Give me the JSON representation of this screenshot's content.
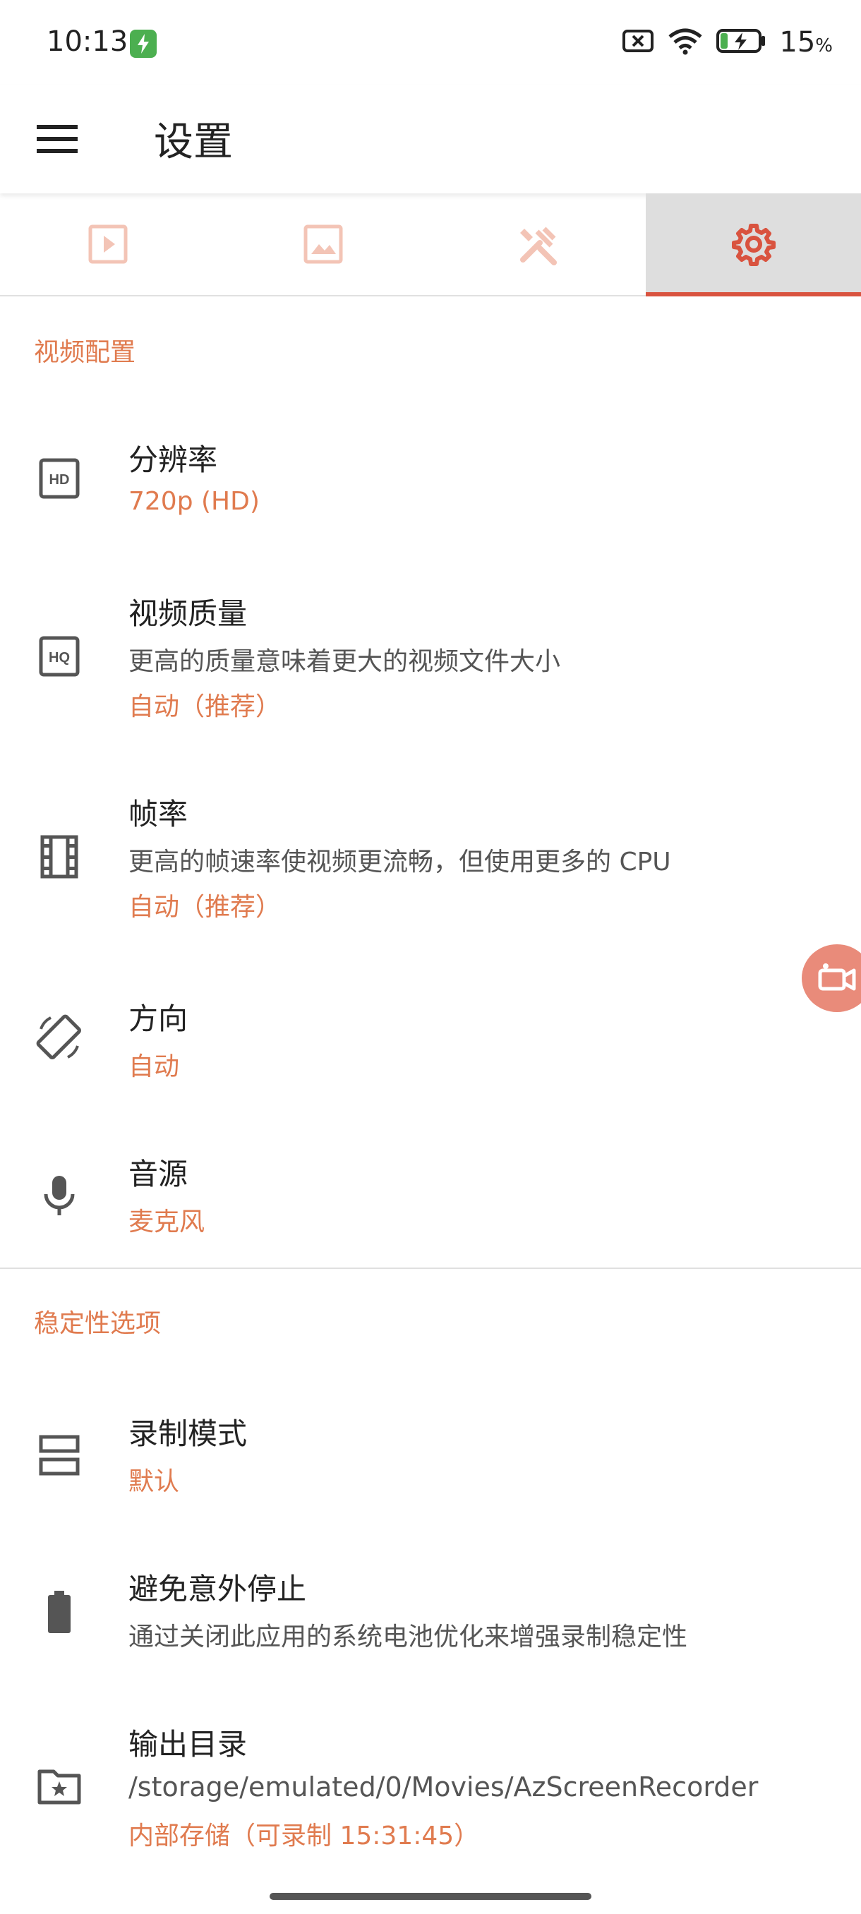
{
  "status_bar": {
    "time": "10:13",
    "battery_pct": "15",
    "battery_unit": "%"
  },
  "app_bar": {
    "title": "设置"
  },
  "tabs": [
    {
      "name": "video",
      "icon": "play-icon",
      "active": false
    },
    {
      "name": "image",
      "icon": "image-icon",
      "active": false
    },
    {
      "name": "tools",
      "icon": "tools-icon",
      "active": false
    },
    {
      "name": "settings",
      "icon": "gear-icon",
      "active": true
    }
  ],
  "sections": {
    "video": {
      "header": "视频配置",
      "items": [
        {
          "title": "分辨率",
          "value": "720p (HD)",
          "icon": "hd-icon"
        },
        {
          "title": "视频质量",
          "subtitle": "更高的质量意味着更大的视频文件大小",
          "value": "自动（推荐）",
          "icon": "hq-icon"
        },
        {
          "title": "帧率",
          "subtitle": "更高的帧速率使视频更流畅，但使用更多的 CPU",
          "value": "自动（推荐）",
          "icon": "film-icon"
        },
        {
          "title": "方向",
          "value": "自动",
          "icon": "rotate-icon"
        },
        {
          "title": "音源",
          "value": "麦克风",
          "icon": "mic-icon"
        }
      ]
    },
    "stability": {
      "header": "稳定性选项",
      "items": [
        {
          "title": "录制模式",
          "value": "默认",
          "icon": "view-agenda-icon"
        },
        {
          "title": "避免意外停止",
          "subtitle": "通过关闭此应用的系统电池优化来增强录制稳定性",
          "icon": "battery-icon"
        },
        {
          "title": "输出目录",
          "subtitle": "/storage/emulated/0/Movies/AzScreenRecorder",
          "value": "内部存储（可录制 15:31:45）",
          "icon": "folder-star-icon"
        }
      ]
    }
  },
  "colors": {
    "accent": "#e07b4f",
    "tab_indicator": "#d9533f",
    "fab": "#e98b7a"
  }
}
